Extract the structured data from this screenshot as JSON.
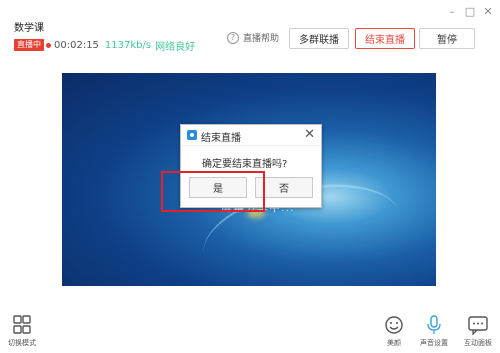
{
  "window": {
    "title": "数学课"
  },
  "status": {
    "badge": "直播中",
    "timer": "00:02:15",
    "speed": "1137kb/s",
    "network": "网络良好"
  },
  "toolbar": {
    "help": "直播帮助",
    "multi": "多群联播",
    "end": "结束直播",
    "pause": "暂停"
  },
  "stage": {
    "overlay_text": "屏幕分享中..."
  },
  "dialog": {
    "title": "结束直播",
    "message": "确定要结束直播吗?",
    "yes": "是",
    "no": "否"
  },
  "bottom": {
    "switch_mode": "切换模式",
    "beauty": "美颜",
    "audio": "声音设置",
    "interact": "互动面板"
  },
  "colors": {
    "accent_red": "#e64033",
    "network_green": "#43c89a",
    "highlight": "#e8202a"
  },
  "icons": [
    "minimize-icon",
    "maximize-icon",
    "close-icon",
    "help-icon",
    "grid-icon",
    "smiley-icon",
    "microphone-icon",
    "chat-icon"
  ]
}
